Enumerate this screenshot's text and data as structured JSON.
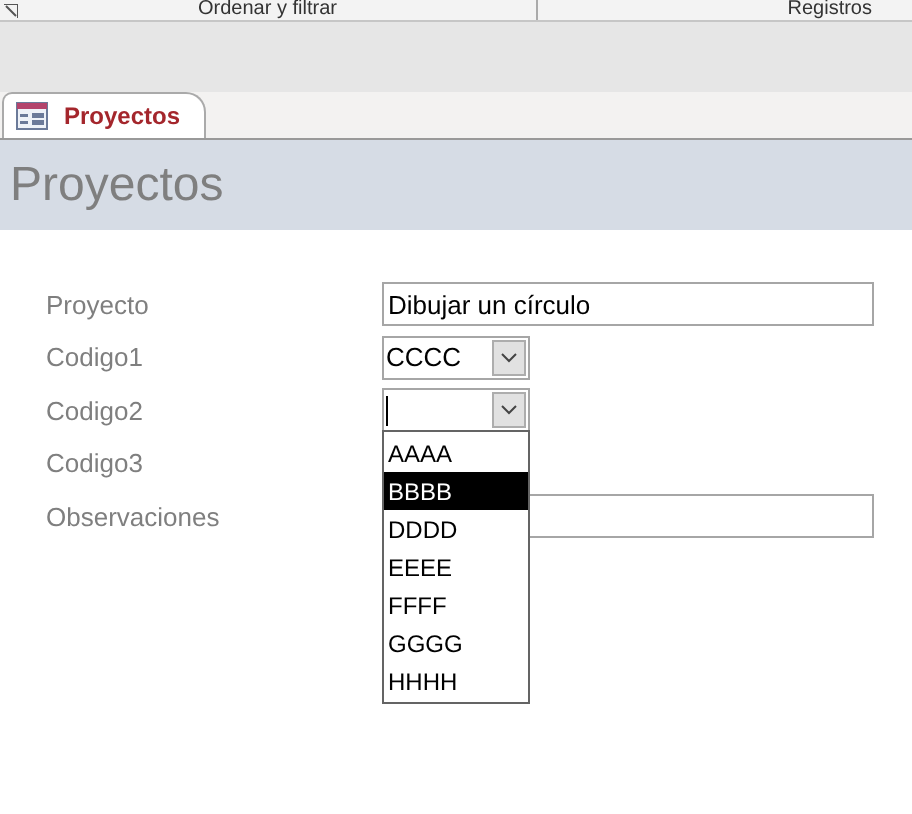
{
  "ribbon": {
    "groups": [
      "Ordenar y filtrar",
      "Registros"
    ]
  },
  "tabs": [
    {
      "label": "Proyectos",
      "selected": true
    }
  ],
  "form": {
    "title": "Proyectos",
    "fields": [
      {
        "label": "Proyecto",
        "kind": "text",
        "value": "Dibujar un círculo"
      },
      {
        "label": "Codigo1",
        "kind": "combo",
        "value": "CCCC",
        "open": false
      },
      {
        "label": "Codigo2",
        "kind": "combo",
        "open": true
      },
      {
        "label": "Codigo3",
        "kind": "hidden"
      },
      {
        "label": "Observaciones",
        "kind": "text"
      }
    ],
    "dropdown": [
      {
        "label": "AAAA",
        "selected": false
      },
      {
        "label": "BBBB",
        "selected": true
      },
      {
        "label": "DDDD",
        "selected": false
      },
      {
        "label": "EEEE",
        "selected": false
      },
      {
        "label": "FFFF",
        "selected": false
      },
      {
        "label": "GGGG",
        "selected": false
      },
      {
        "label": "HHHH",
        "selected": false
      }
    ]
  }
}
